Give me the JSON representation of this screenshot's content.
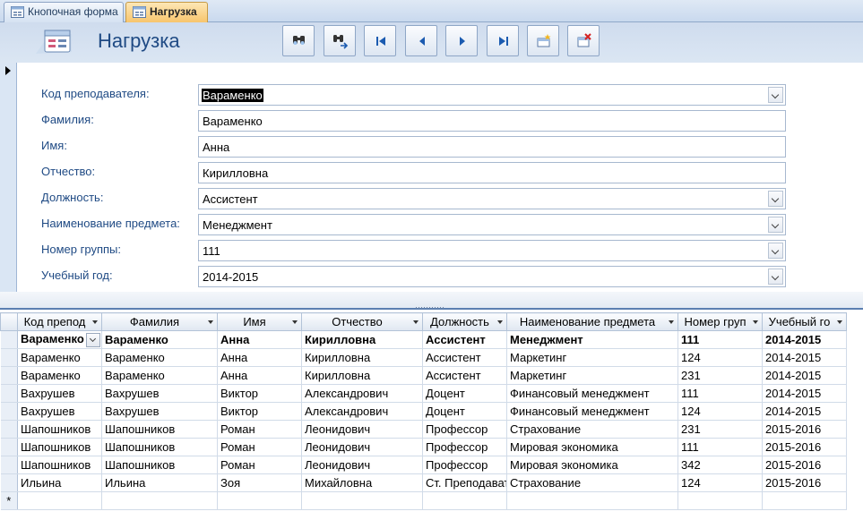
{
  "tabs": [
    {
      "label": "Кнопочная форма",
      "active": false
    },
    {
      "label": "Нагрузка",
      "active": true
    }
  ],
  "header": {
    "title": "Нагрузка",
    "nav_icons": [
      "find-icon",
      "find-next-icon",
      "first-record-icon",
      "previous-record-icon",
      "next-record-icon",
      "last-record-icon",
      "new-record-icon",
      "delete-record-icon"
    ]
  },
  "form": {
    "fields": [
      {
        "label": "Код преподавателя:",
        "value": "Вараменко",
        "type": "combo",
        "selected": true
      },
      {
        "label": "Фамилия:",
        "value": "Вараменко",
        "type": "text"
      },
      {
        "label": "Имя:",
        "value": "Анна",
        "type": "text"
      },
      {
        "label": "Отчество:",
        "value": "Кирилловна",
        "type": "text"
      },
      {
        "label": "Должность:",
        "value": "Ассистент",
        "type": "combo"
      },
      {
        "label": "Наименование предмета:",
        "value": "Менеджмент",
        "type": "combo"
      },
      {
        "label": "Номер группы:",
        "value": "111",
        "type": "combo"
      },
      {
        "label": "Учебный год:",
        "value": "2014-2015",
        "type": "combo"
      }
    ]
  },
  "datasheet": {
    "columns": [
      "Код препод",
      "Фамилия",
      "Имя",
      "Отчество",
      "Должность",
      "Наименование предмета",
      "Номер груп",
      "Учебный го"
    ],
    "rows": [
      [
        "Вараменко",
        "Вараменко",
        "Анна",
        "Кирилловна",
        "Ассистент",
        "Менеджмент",
        "111",
        "2014-2015"
      ],
      [
        "Вараменко",
        "Вараменко",
        "Анна",
        "Кирилловна",
        "Ассистент",
        "Маркетинг",
        "124",
        "2014-2015"
      ],
      [
        "Вараменко",
        "Вараменко",
        "Анна",
        "Кирилловна",
        "Ассистент",
        "Маркетинг",
        "231",
        "2014-2015"
      ],
      [
        "Вахрушев",
        "Вахрушев",
        "Виктор",
        "Александрович",
        "Доцент",
        "Финансовый менеджмент",
        "111",
        "2014-2015"
      ],
      [
        "Вахрушев",
        "Вахрушев",
        "Виктор",
        "Александрович",
        "Доцент",
        "Финансовый менеджмент",
        "124",
        "2014-2015"
      ],
      [
        "Шапошников",
        "Шапошников",
        "Роман",
        "Леонидович",
        "Профессор",
        "Страхование",
        "231",
        "2015-2016"
      ],
      [
        "Шапошников",
        "Шапошников",
        "Роман",
        "Леонидович",
        "Профессор",
        "Мировая экономика",
        "111",
        "2015-2016"
      ],
      [
        "Шапошников",
        "Шапошников",
        "Роман",
        "Леонидович",
        "Профессор",
        "Мировая экономика",
        "342",
        "2015-2016"
      ],
      [
        "Ильина",
        "Ильина",
        "Зоя",
        "Михайловна",
        "Ст. Преподаватель",
        "Страхование",
        "124",
        "2015-2016"
      ]
    ],
    "new_row_marker": "*",
    "current_row": 0
  }
}
